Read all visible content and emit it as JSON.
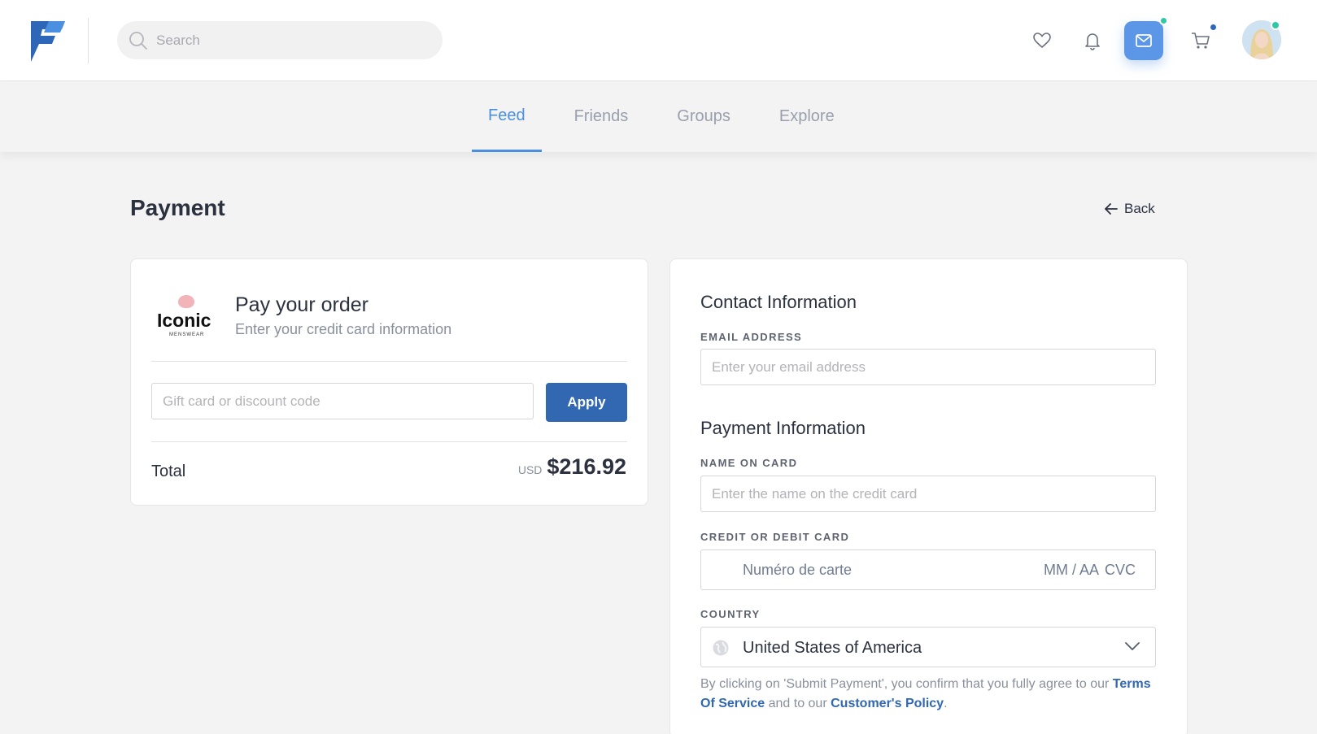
{
  "header": {
    "logo_icon": "brand-f-logo",
    "search_placeholder": "Search",
    "icons": [
      "heart-icon",
      "bell-icon",
      "mail-icon",
      "cart-icon"
    ],
    "accent_color": "#5c96e6",
    "online_status_color": "#2ec8a8"
  },
  "nav": {
    "tabs": [
      {
        "label": "Feed",
        "active": true
      },
      {
        "label": "Friends",
        "active": false
      },
      {
        "label": "Groups",
        "active": false
      },
      {
        "label": "Explore",
        "active": false
      }
    ]
  },
  "page": {
    "title": "Payment",
    "back_label": "Back"
  },
  "order": {
    "brand_name": "Iconic",
    "brand_sub": "MENSWEAR",
    "title": "Pay your order",
    "subtitle": "Enter your credit card information",
    "gift_placeholder": "Gift card or discount code",
    "apply_label": "Apply",
    "total_label": "Total",
    "currency": "USD",
    "amount": "$216.92",
    "button_color": "#3267b2"
  },
  "contact": {
    "title": "Contact Information",
    "email_label": "EMAIL ADDRESS",
    "email_placeholder": "Enter your email address"
  },
  "payment": {
    "title": "Payment Information",
    "name_label": "NAME ON CARD",
    "name_placeholder": "Enter the name on the credit card",
    "card_label": "CREDIT OR DEBIT CARD",
    "card_number_placeholder": "Numéro de carte",
    "card_expiry_placeholder": "MM / AA",
    "card_cvc_placeholder": "CVC",
    "country_label": "COUNTRY",
    "country_value": "United States of America",
    "terms_prefix": "By clicking on 'Submit Payment', you confirm that you fully agree to our ",
    "terms_link": "Terms Of Service",
    "terms_middle": " and to our ",
    "policy_link": "Customer's Policy",
    "terms_suffix": "."
  }
}
